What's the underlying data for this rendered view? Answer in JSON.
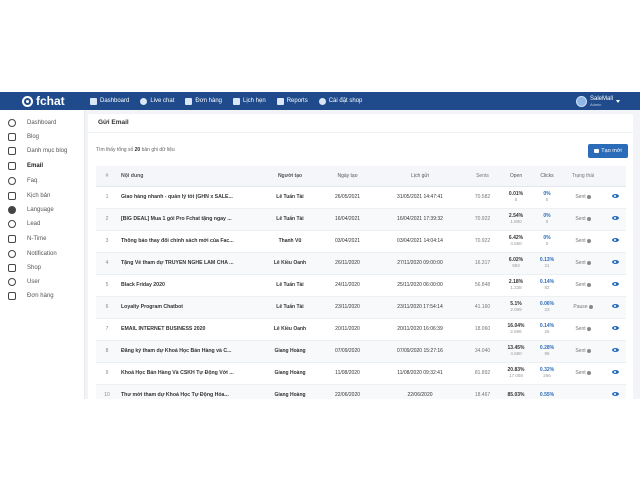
{
  "colors": {
    "topbar": "#1f4b8c",
    "accent": "#2b6cb8",
    "background": "#f2f4f7"
  },
  "brand": {
    "name": "fchat"
  },
  "nav": [
    {
      "label": "Dashboard",
      "icon": "home-icon"
    },
    {
      "label": "Live chat",
      "icon": "chat-icon"
    },
    {
      "label": "Đơn hàng",
      "icon": "cart-icon"
    },
    {
      "label": "Lịch hẹn",
      "icon": "calendar-icon"
    },
    {
      "label": "Reports",
      "icon": "chart-icon"
    },
    {
      "label": "Cài đặt shop",
      "icon": "gear-icon"
    }
  ],
  "user": {
    "name": "SaleMall",
    "role": "Admin"
  },
  "sidebar": [
    {
      "label": "Dashboard",
      "icon": "dashboard-icon"
    },
    {
      "label": "Blog",
      "icon": "blog-icon"
    },
    {
      "label": "Danh mục blog",
      "icon": "folder-icon"
    },
    {
      "label": "Email",
      "icon": "email-icon",
      "active": true
    },
    {
      "label": "Faq",
      "icon": "question-icon"
    },
    {
      "label": "Kịch bản",
      "icon": "script-icon"
    },
    {
      "label": "Language",
      "icon": "language-icon"
    },
    {
      "label": "Lead",
      "icon": "lead-icon"
    },
    {
      "label": "N-Time",
      "icon": "trend-icon"
    },
    {
      "label": "Notification",
      "icon": "bell-icon"
    },
    {
      "label": "Shop",
      "icon": "shop-icon"
    },
    {
      "label": "User",
      "icon": "user-icon"
    },
    {
      "label": "Đơn hàng",
      "icon": "order-icon"
    }
  ],
  "page": {
    "title": "Gửi Email",
    "found_prefix": "Tìm thấy tổng số",
    "found_count": "20",
    "found_suffix": "bản ghi dữ liệu",
    "create_label": "Tạo mới"
  },
  "table": {
    "headers": [
      "#",
      "Nội dung",
      "Người tạo",
      "Ngày tạo",
      "Lịch gửi",
      "Sents",
      "Open",
      "Clicks",
      "Trạng thái",
      ""
    ],
    "rows": [
      {
        "idx": "1",
        "name": "Giao hàng nhanh - quản lý tốt (GHN x SALE...",
        "creator": "Lê Tuấn Tài",
        "date": "26/05/2021",
        "sched": "31/05/2021 14:47:41",
        "sents": "70.582",
        "open_pct": "0.01%",
        "open_n": "5",
        "click_pct": "0%",
        "click_n": "0",
        "status": "Sent"
      },
      {
        "idx": "2",
        "name": "[BIG DEAL] Mua 1 gói Pro Fchat tặng ngay ...",
        "creator": "Lê Tuấn Tài",
        "date": "16/04/2021",
        "sched": "16/04/2021 17:39:32",
        "sents": "70.922",
        "open_pct": "2.54%",
        "open_n": "1.800",
        "click_pct": "0%",
        "click_n": "0",
        "status": "Sent"
      },
      {
        "idx": "3",
        "name": "Thông báo thay đổi chính sách mới của Fac...",
        "creator": "Thanh Vũ",
        "date": "03/04/2021",
        "sched": "03/04/2021 14:04:14",
        "sents": "70.922",
        "open_pct": "6.42%",
        "open_n": "4.550",
        "click_pct": "0%",
        "click_n": "0",
        "status": "Sent"
      },
      {
        "idx": "4",
        "name": "Tặng Vé tham dự TRUYỀN NGHỀ LÀM CHA ...",
        "creator": "Lê Kiều Oanh",
        "date": "26/11/2020",
        "sched": "27/11/2020 09:00:00",
        "sents": "16.317",
        "open_pct": "6.02%",
        "open_n": "983",
        "click_pct": "0.13%",
        "click_n": "21",
        "status": "Sent"
      },
      {
        "idx": "5",
        "name": "Black Friday 2020",
        "creator": "Lê Tuấn Tài",
        "date": "24/11/2020",
        "sched": "25/11/2020 06:00:00",
        "sents": "56.848",
        "open_pct": "2.18%",
        "open_n": "1.238",
        "click_pct": "0.14%",
        "click_n": "82",
        "status": "Sent"
      },
      {
        "idx": "6",
        "name": "Loyalty Program Chatbot",
        "creator": "Lê Tuấn Tài",
        "date": "23/11/2020",
        "sched": "23/11/2020 17:54:14",
        "sents": "41.160",
        "open_pct": "5.1%",
        "open_n": "2.099",
        "click_pct": "0.06%",
        "click_n": "23",
        "status": "Pause"
      },
      {
        "idx": "7",
        "name": "EMAIL INTERNET BUSINESS 2020",
        "creator": "Lê Kiều Oanh",
        "date": "20/11/2020",
        "sched": "20/11/2020 16:06:39",
        "sents": "18.060",
        "open_pct": "16.04%",
        "open_n": "2.896",
        "click_pct": "0.14%",
        "click_n": "26",
        "status": "Sent"
      },
      {
        "idx": "8",
        "name": "Đăng ký tham dự Khoá Học Bán Hàng và C...",
        "creator": "Giang Hoàng",
        "date": "07/09/2020",
        "sched": "07/09/2020 15:27:16",
        "sents": "34.040",
        "open_pct": "13.45%",
        "open_n": "4.580",
        "click_pct": "0.28%",
        "click_n": "96",
        "status": "Sent"
      },
      {
        "idx": "9",
        "name": "Khoá Học Bán Hàng Và CSKH Tự Động Với ...",
        "creator": "Giang Hoàng",
        "date": "11/08/2020",
        "sched": "11/08/2020 09:32:41",
        "sents": "81.892",
        "open_pct": "20.83%",
        "open_n": "17.058",
        "click_pct": "0.32%",
        "click_n": "266",
        "status": "Sent"
      },
      {
        "idx": "10",
        "name": "Thư mời tham dự Khoá Học Tự Động Hóa...",
        "creator": "Giang Hoàng",
        "date": "22/06/2020",
        "sched": "22/06/2020",
        "sents": "18.467",
        "open_pct": "85.03%",
        "open_n": "",
        "click_pct": "0.55%",
        "click_n": "",
        "status": ""
      }
    ]
  }
}
